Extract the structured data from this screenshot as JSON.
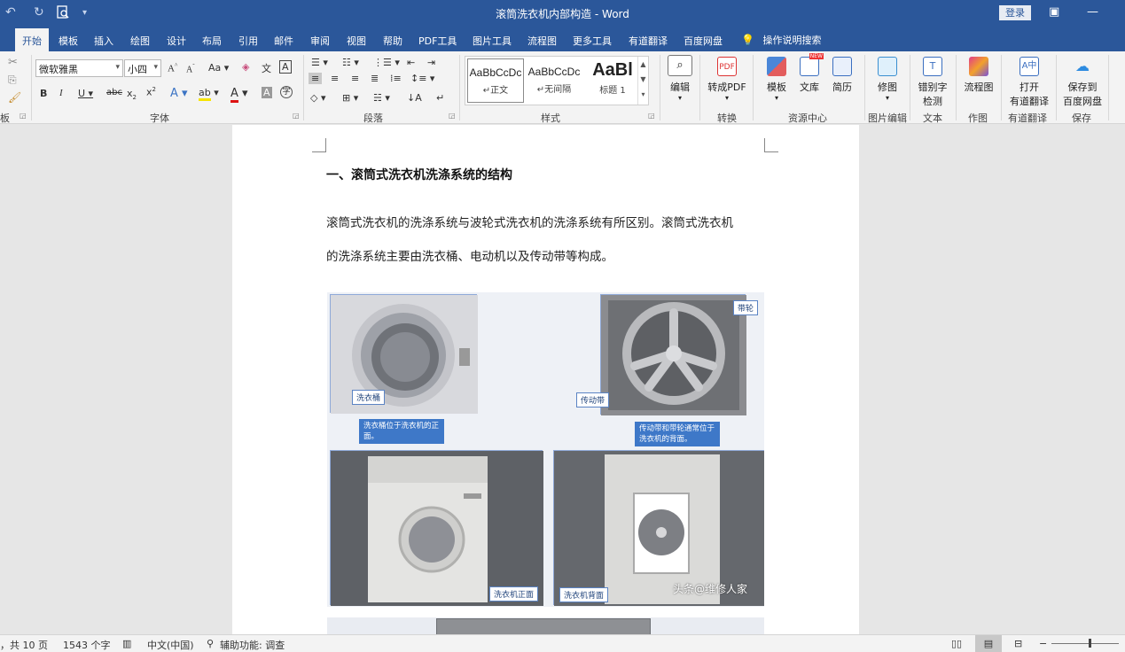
{
  "window": {
    "title": "滚筒洗衣机内部构造  -  Word",
    "login_label": "登录"
  },
  "tabs": [
    "开始",
    "模板",
    "插入",
    "绘图",
    "设计",
    "布局",
    "引用",
    "邮件",
    "审阅",
    "视图",
    "帮助",
    "PDF工具",
    "图片工具",
    "流程图",
    "更多工具",
    "有道翻译",
    "百度网盘"
  ],
  "active_tab": "开始",
  "tell_me": "操作说明搜索",
  "ribbon": {
    "clipboard_label": "板",
    "font": {
      "name": "微软雅黑",
      "size": "小四",
      "group_label": "字体"
    },
    "paragraph_label": "段落",
    "styles": {
      "group_label": "样式",
      "items": [
        {
          "sample": "AaBbCcDc",
          "name": "↵正文"
        },
        {
          "sample": "AaBbCcDc",
          "name": "↵无间隔"
        },
        {
          "sample": "AaBl",
          "name": "标题 1"
        }
      ]
    },
    "editing_label": "编辑",
    "convert": {
      "button": "转成PDF",
      "group_label": "转换"
    },
    "resources": {
      "template": "模板",
      "library": "文库",
      "resume": "简历",
      "group_label": "资源中心"
    },
    "image_edit": {
      "button": "修图",
      "group_label": "图片编辑"
    },
    "text": {
      "button_line1": "错别字",
      "button_line2": "检测",
      "group_label": "文本"
    },
    "drawing": {
      "button": "流程图",
      "group_label": "作图"
    },
    "youdao": {
      "button_line1": "打开",
      "button_line2": "有道翻译",
      "group_label": "有道翻译"
    },
    "save": {
      "button_line1": "保存到",
      "button_line2": "百度网盘",
      "group_label": "保存"
    }
  },
  "document": {
    "heading": "一、滚筒式洗衣机洗涤系统的结构",
    "paragraph_line1": "滚筒式洗衣机的洗涤系统与波轮式洗衣机的洗涤系统有所区别。滚筒式洗衣机",
    "paragraph_line2": "的洗涤系统主要由洗衣桶、电动机以及传动带等构成。",
    "figure": {
      "label_drum": "洗衣桶",
      "label_pulley": "带轮",
      "label_belt": "传动带",
      "label_front": "洗衣机正面",
      "label_back": "洗衣机背面",
      "note_drum": "洗衣桶位于洗衣机的正面。",
      "note_belt": "传动带和带轮通常位于洗衣机的背面。",
      "watermark": "头条@维修人家"
    }
  },
  "status": {
    "pages": "，共 10 页",
    "words": "1543 个字",
    "language": "中文(中国)",
    "accessibility": "辅助功能: 调查"
  },
  "colors": {
    "accent": "#2b579a",
    "ribbon_bg": "#f3f3f3",
    "doc_bg": "#e6e6e6"
  }
}
